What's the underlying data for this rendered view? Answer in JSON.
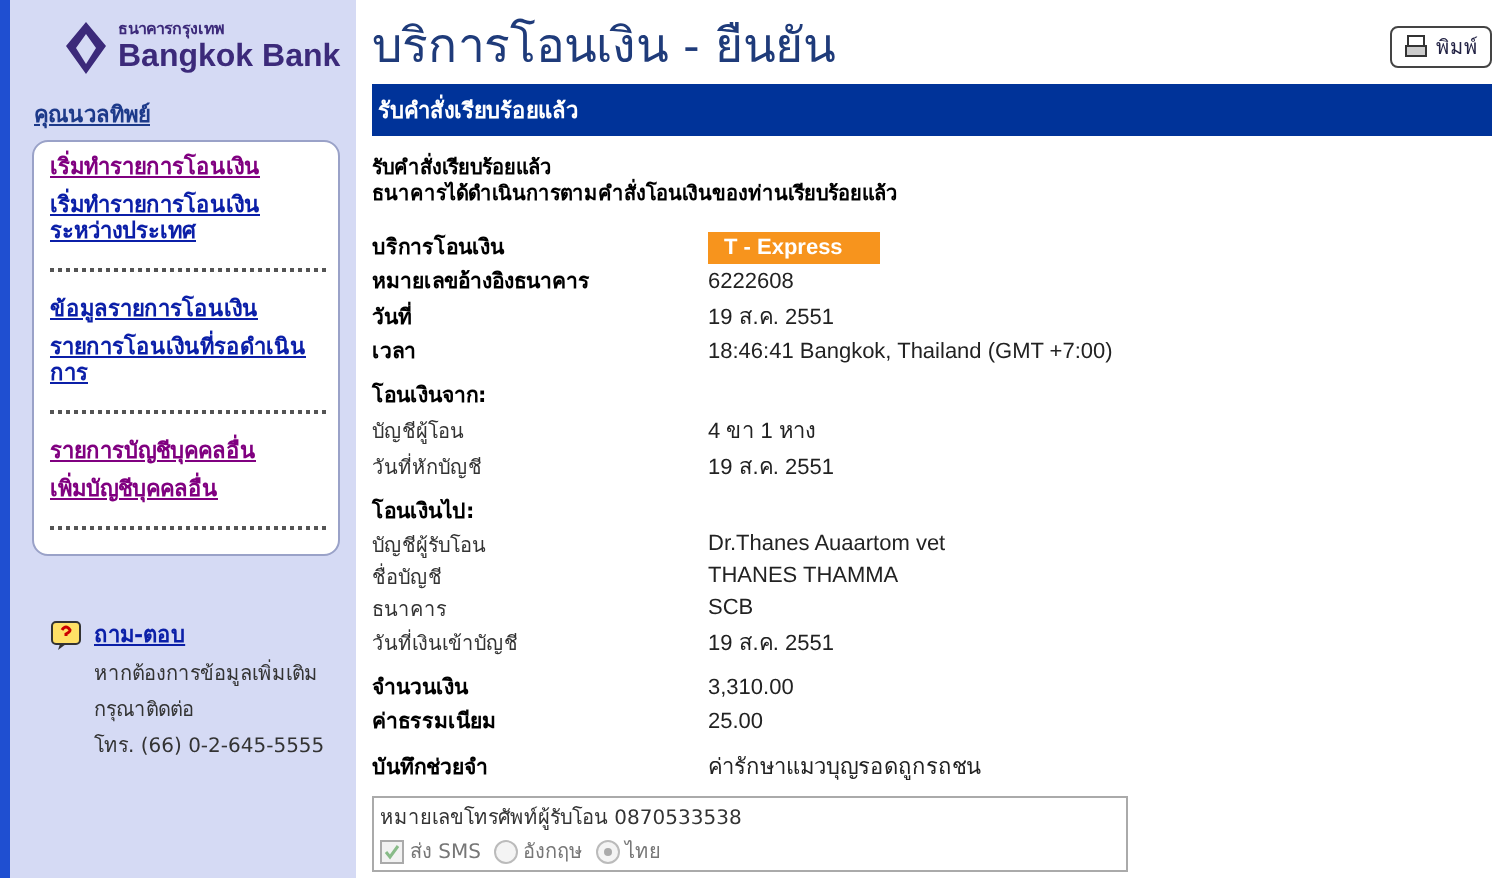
{
  "sidebar": {
    "logo": {
      "thai": "ธนาคารกรุงเทพ",
      "name": "Bangkok Bank"
    },
    "user": "คุณนวลทิพย์",
    "menu": [
      {
        "kind": "link",
        "label": "เริ่มทำรายการโอนเงิน",
        "visited": true
      },
      {
        "kind": "link",
        "label": "เริ่มทำรายการโอนเงินระหว่างประเทศ",
        "visited": false
      },
      {
        "kind": "divider"
      },
      {
        "kind": "link",
        "label": "ข้อมูลรายการโอนเงิน",
        "visited": false
      },
      {
        "kind": "link",
        "label": "รายการโอนเงินที่รอดำเนินการ",
        "visited": false
      },
      {
        "kind": "divider"
      },
      {
        "kind": "link",
        "label": "รายการบัญชีบุคคลอื่น",
        "visited": true
      },
      {
        "kind": "link",
        "label": "เพิ่มบัญชีบุคคลอื่น",
        "visited": true
      },
      {
        "kind": "divider"
      }
    ],
    "help": {
      "link": "ถาม-ตอบ",
      "lines": [
        "หากต้องการข้อมูลเพิ่มเติม",
        "กรุณาติดต่อ",
        "โทร. (66) 0-2-645-5555"
      ]
    }
  },
  "page": {
    "title": "บริการโอนเงิน - ยืนยัน",
    "print_button": "พิมพ์",
    "banner": "รับคำสั่งเรียบร้อยแล้ว",
    "message": [
      "รับคำสั่งเรียบร้อยแล้ว",
      "ธนาคารได้ดำเนินการตามคำสั่งโอนเงินของท่านเรียบร้อยแล้ว"
    ],
    "groups": [
      [
        {
          "kind": "badge",
          "label": "บริการโอนเงิน",
          "value": "T - Express"
        },
        {
          "kind": "strong",
          "label": "หมายเลขอ้างอิงธนาคาร",
          "value": "6222608"
        },
        {
          "kind": "strong",
          "label": "วันที่",
          "value": "19 ส.ค. 2551"
        },
        {
          "kind": "strong",
          "label": "เวลา",
          "value": "18:46:41 Bangkok, Thailand (GMT +7:00)"
        }
      ],
      [
        {
          "kind": "section",
          "label": "โอนเงินจาก:"
        },
        {
          "kind": "plain",
          "label": "บัญชีผู้โอน",
          "value": "4 ขา 1 หาง"
        },
        {
          "kind": "plain",
          "label": "วันที่หักบัญชี",
          "value": "19 ส.ค. 2551"
        }
      ],
      [
        {
          "kind": "section",
          "label": "โอนเงินไป:"
        },
        {
          "kind": "plain",
          "label": "บัญชีผู้รับโอน",
          "value": "Dr.Thanes Auaartom vet"
        },
        {
          "kind": "plain",
          "label": "ชื่อบัญชี",
          "value": "THANES THAMMA"
        },
        {
          "kind": "plain",
          "label": "ธนาคาร",
          "value": "SCB"
        },
        {
          "kind": "plain",
          "label": "วันที่เงินเข้าบัญชี",
          "value": "19 ส.ค. 2551"
        }
      ],
      [
        {
          "kind": "strong",
          "label": "จำนวนเงิน",
          "value": "3,310.00"
        },
        {
          "kind": "strong",
          "label": "ค่าธรรมเนียม",
          "value": "25.00"
        }
      ],
      [
        {
          "kind": "strong",
          "label": "บันทึกช่วยจำ",
          "value": "ค่ารักษาแมวบุญรอดถูกรถชน"
        }
      ]
    ],
    "sms": {
      "phone": "หมายเลขโทรศัพท์ผู้รับโอน 0870533538",
      "disabled": true,
      "send": {
        "label": "ส่ง SMS",
        "checked": true
      },
      "languages": [
        {
          "label": "อังกฤษ",
          "selected": false
        },
        {
          "label": "ไทย",
          "selected": true
        }
      ]
    }
  }
}
